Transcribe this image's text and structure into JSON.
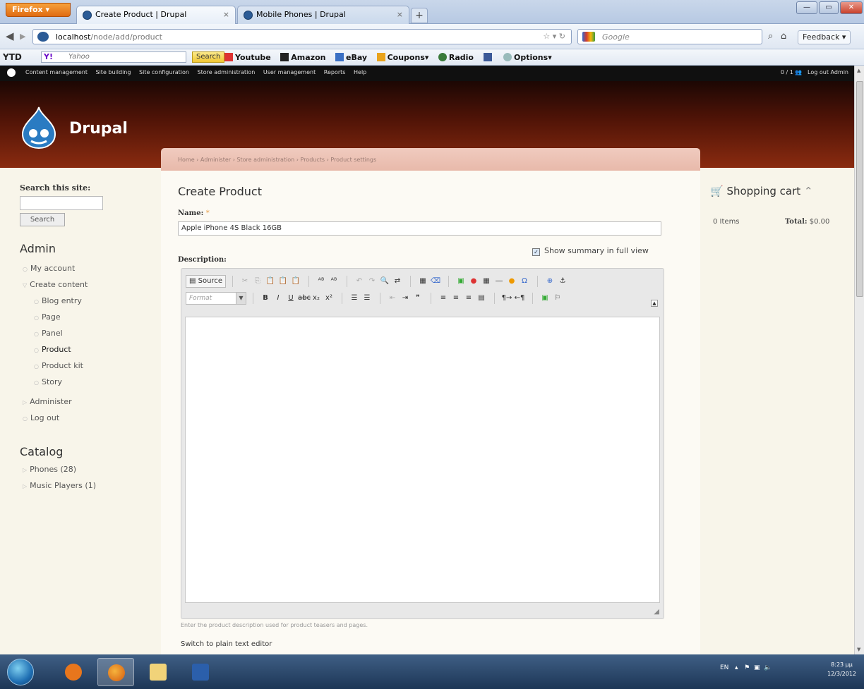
{
  "browser": {
    "firefox_menu": "Firefox ▾",
    "tabs": [
      {
        "title": "Create Product | Drupal",
        "active": true
      },
      {
        "title": "Mobile Phones | Drupal",
        "active": false
      }
    ],
    "new_tab": "+",
    "url_host": "localhost",
    "url_path": "/node/add/product",
    "search_placeholder": "Google",
    "feedback_label": "Feedback ▾",
    "yahoo_label": "Y!",
    "yahoo_placeholder": "Yahoo",
    "yahoo_search_label": "Search",
    "ytd_label": "YTD",
    "toolbar_items": [
      "Youtube",
      "Amazon",
      "eBay",
      "Coupons▾",
      "Radio",
      "Options▾"
    ]
  },
  "admin_menu": {
    "items": [
      "Content management",
      "Site building",
      "Site configuration",
      "Store administration",
      "User management",
      "Reports",
      "Help"
    ],
    "users": "0 / 1",
    "logout": "Log out Admin"
  },
  "site": {
    "name": "Drupal"
  },
  "breadcrumb": "Home › Administer › Store administration › Products › Product settings",
  "left_sidebar": {
    "search_label": "Search this site:",
    "search_button": "Search",
    "admin_heading": "Admin",
    "admin_items": [
      {
        "label": "My account",
        "level": 0
      },
      {
        "label": "Create content",
        "level": 0
      },
      {
        "label": "Blog entry",
        "level": 1
      },
      {
        "label": "Page",
        "level": 1
      },
      {
        "label": "Panel",
        "level": 1
      },
      {
        "label": "Product",
        "level": 1
      },
      {
        "label": "Product kit",
        "level": 1
      },
      {
        "label": "Story",
        "level": 1
      },
      {
        "label": "Administer",
        "level": 0
      },
      {
        "label": "Log out",
        "level": 0
      }
    ],
    "catalog_heading": "Catalog",
    "catalog_items": [
      "Phones (28)",
      "Music Players (1)"
    ]
  },
  "main": {
    "title": "Create Product",
    "name_label": "Name:",
    "required_marker": "*",
    "name_value": "Apple iPhone 4S Black 16GB",
    "description_label": "Description:",
    "summary_checkbox_label": "Show summary in full view",
    "summary_checked": true,
    "editor_source_label": "Source",
    "editor_format_placeholder": "Format",
    "editor_hint": "Enter the product description used for product teasers and pages.",
    "switch_editor_link": "Switch to plain text editor"
  },
  "cart": {
    "heading": "Shopping cart",
    "items": "0 Items",
    "total_label": "Total:",
    "total_value": "$0.00"
  },
  "taskbar": {
    "lang": "EN",
    "time": "8:23 μμ",
    "date": "12/3/2012"
  },
  "colors": {
    "header_dark": "#1c0704",
    "header_light": "#8a2b10",
    "page_bg": "#f8f5ea",
    "breadcrumb_bg": "#e8b9aa"
  }
}
